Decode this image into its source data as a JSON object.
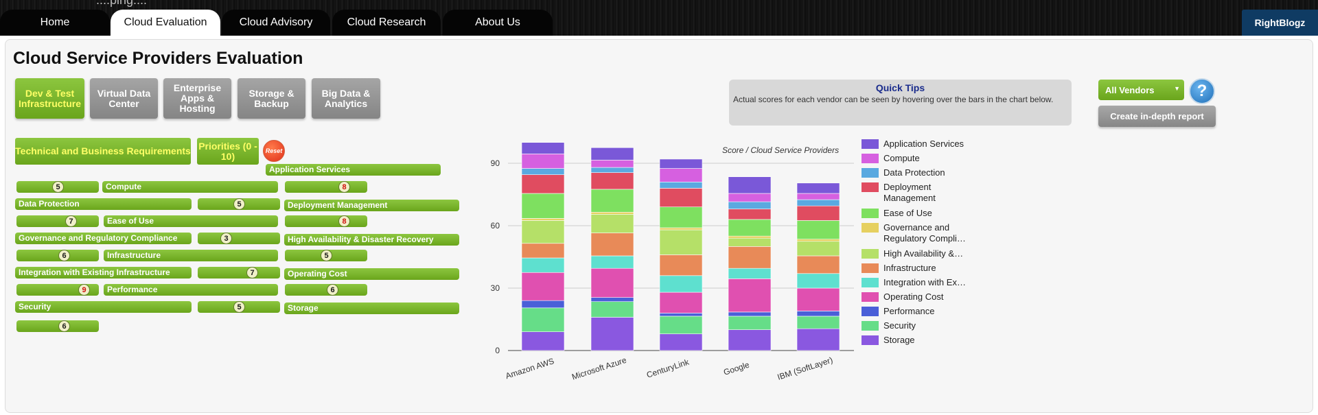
{
  "nav": {
    "logo_fragment": "....ping....",
    "tabs": [
      {
        "label": "Home",
        "active": false
      },
      {
        "label": "Cloud Evaluation",
        "active": true
      },
      {
        "label": "Cloud Advisory",
        "active": false
      },
      {
        "label": "Cloud Research",
        "active": false
      },
      {
        "label": "About Us",
        "active": false
      }
    ],
    "brand_label": "RightBlogz"
  },
  "page": {
    "title": "Cloud Service Providers Evaluation"
  },
  "categories": [
    {
      "label": "Dev & Test Infrastructure",
      "active": true
    },
    {
      "label": "Virtual Data Center",
      "active": false
    },
    {
      "label": "Enterprise Apps & Hosting",
      "active": false
    },
    {
      "label": "Storage & Backup",
      "active": false
    },
    {
      "label": "Big Data & Analytics",
      "active": false
    }
  ],
  "quick_tips": {
    "title": "Quick Tips",
    "text": "Actual scores for each vendor can be seen by hovering over the bars in the chart below."
  },
  "vendor_select": {
    "value": "All Vendors"
  },
  "help_label": "?",
  "report_button": "Create in-depth report",
  "headers": {
    "requirements": "Technical and Business Requirements",
    "priorities": "Priorities (0 - 10)",
    "reset": "Reset"
  },
  "requirements": [
    {
      "name": "Application Services",
      "priority": 8
    },
    {
      "name": "Compute",
      "priority": 5
    },
    {
      "name": "Data Protection",
      "priority": 5
    },
    {
      "name": "Deployment Management",
      "priority": 8
    },
    {
      "name": "Ease of Use",
      "priority": 7
    },
    {
      "name": "Governance and Regulatory Compliance",
      "priority": 3
    },
    {
      "name": "High Availability & Disaster Recovery",
      "priority": 5
    },
    {
      "name": "Infrastructure",
      "priority": 6
    },
    {
      "name": "Integration with Existing Infrastructure",
      "priority": 7
    },
    {
      "name": "Operating Cost",
      "priority": 6
    },
    {
      "name": "Performance",
      "priority": 9
    },
    {
      "name": "Security",
      "priority": 5
    },
    {
      "name": "Storage",
      "priority": 6
    }
  ],
  "legend_labels": [
    "Application Services",
    "Compute",
    "Data Protection",
    "Deployment Management",
    "Ease of Use",
    "Governance and Regulatory Compli…",
    "High Availability &…",
    "Infrastructure",
    "Integration with Ex…",
    "Operating Cost",
    "Performance",
    "Security",
    "Storage"
  ],
  "chart_data": {
    "type": "bar",
    "stacked": true,
    "title": "Score / Cloud Service Providers",
    "xlabel": "",
    "ylabel": "",
    "ylim": [
      0,
      100
    ],
    "yticks": [
      0,
      30,
      60,
      90
    ],
    "grid": true,
    "legend_position": "right",
    "categories": [
      "Amazon AWS",
      "Microsoft Azure",
      "CenturyLink",
      "Google",
      "IBM (SoftLayer)"
    ],
    "series": [
      {
        "name": "Storage",
        "color": "#8a58e0",
        "values": [
          9,
          16,
          8,
          10,
          10.5
        ]
      },
      {
        "name": "Security",
        "color": "#66dd88",
        "values": [
          11.5,
          7.5,
          8.5,
          6.5,
          6
        ]
      },
      {
        "name": "Performance",
        "color": "#4a5fd8",
        "values": [
          3.5,
          2,
          1.5,
          2,
          2.5
        ]
      },
      {
        "name": "Operating Cost",
        "color": "#e050b0",
        "values": [
          13.5,
          14,
          10,
          16,
          11
        ]
      },
      {
        "name": "Integration with Existing Infrastructure",
        "color": "#5ee0cf",
        "values": [
          7,
          6,
          8,
          5,
          7
        ]
      },
      {
        "name": "Infrastructure",
        "color": "#e88a58",
        "values": [
          7,
          11,
          10,
          10.5,
          8.5
        ]
      },
      {
        "name": "High Availability & Disaster Recovery",
        "color": "#b5e068",
        "values": [
          11,
          9,
          12,
          4,
          7
        ]
      },
      {
        "name": "Governance and Regulatory Compliance",
        "color": "#e6d060",
        "values": [
          1,
          1,
          1,
          1,
          1
        ]
      },
      {
        "name": "Ease of Use",
        "color": "#7ee060",
        "values": [
          12,
          11,
          10,
          8,
          9
        ]
      },
      {
        "name": "Deployment Management",
        "color": "#e04c60",
        "values": [
          9,
          8,
          9,
          5,
          7
        ]
      },
      {
        "name": "Data Protection",
        "color": "#5aa9e0",
        "values": [
          3,
          2.5,
          3,
          3.5,
          3
        ]
      },
      {
        "name": "Compute",
        "color": "#d660e0",
        "values": [
          7,
          3.5,
          6.5,
          4,
          3
        ]
      },
      {
        "name": "Application Services",
        "color": "#7a58d8",
        "values": [
          5.5,
          6,
          4.5,
          8,
          5
        ]
      }
    ]
  }
}
